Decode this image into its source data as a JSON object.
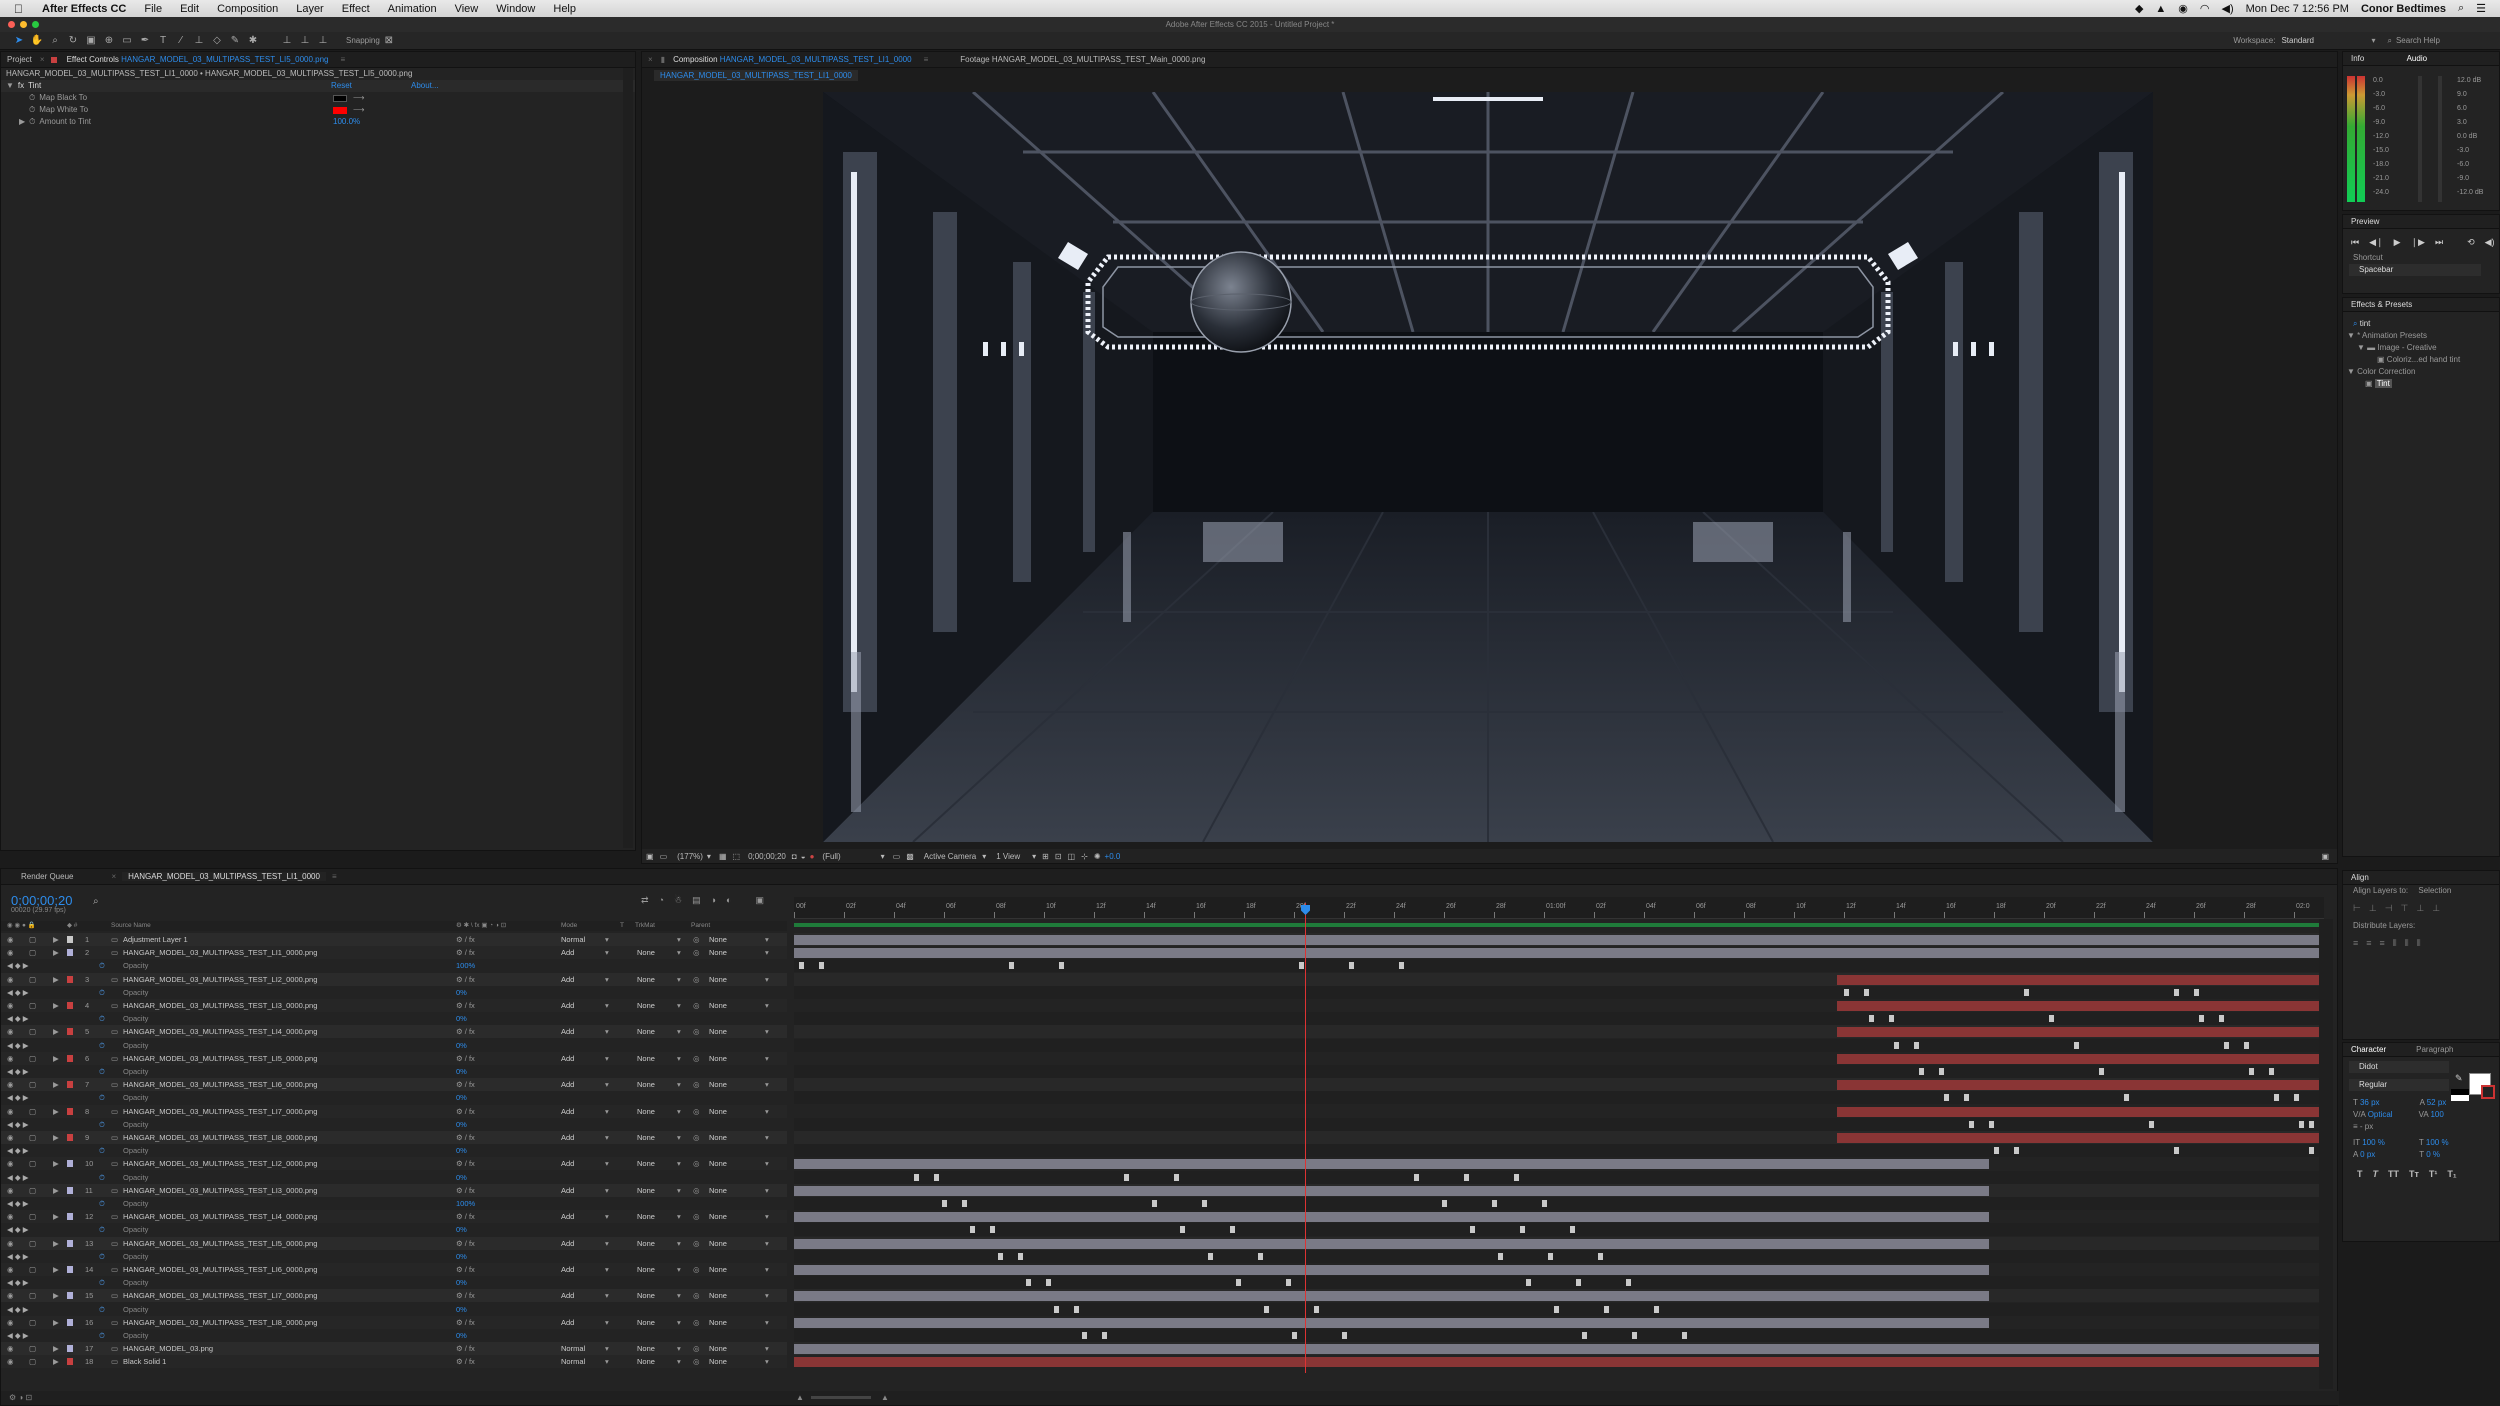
{
  "menubar": {
    "app": "After Effects CC",
    "items": [
      "File",
      "Edit",
      "Composition",
      "Layer",
      "Effect",
      "Animation",
      "View",
      "Window",
      "Help"
    ],
    "clock": "Mon Dec 7  12:56 PM",
    "user": "Conor Bedtimes"
  },
  "window_title": "Adobe After Effects CC 2015 - Untitled Project *",
  "toolbar": {
    "snapping": "Snapping",
    "workspace_label": "Workspace:",
    "workspace_value": "Standard",
    "search_help": "Search Help"
  },
  "left_panel": {
    "tab_project": "Project",
    "tab_effect_controls_prefix": "Effect Controls",
    "tab_effect_controls_name": "HANGAR_MODEL_03_MULTIPASS_TEST_LI5_0000.png",
    "breadcrumb": "HANGAR_MODEL_03_MULTIPASS_TEST_LI1_0000 • HANGAR_MODEL_03_MULTIPASS_TEST_LI5_0000.png",
    "effect_name": "Tint",
    "reset": "Reset",
    "about": "About...",
    "map_black": "Map Black To",
    "map_white": "Map White To",
    "amount_label": "Amount to Tint",
    "amount_value": "100.0%",
    "colors": {
      "black": "#000000",
      "white": "#ff0000"
    }
  },
  "viewer": {
    "tab_comp_prefix": "Composition",
    "tab_comp_name": "HANGAR_MODEL_03_MULTIPASS_TEST_LI1_0000",
    "tab_footage": "Footage HANGAR_MODEL_03_MULTIPASS_TEST_Main_0000.png",
    "sub_tab": "HANGAR_MODEL_03_MULTIPASS_TEST_LI1_0000",
    "zoom": "(177%)",
    "timecode": "0;00;00;20",
    "resolution": "(Full)",
    "camera": "Active Camera",
    "views": "1 View",
    "exposure": "+0.0"
  },
  "right_panel": {
    "info_tab": "Info",
    "audio_tab": "Audio",
    "audio_left_scale": [
      "0.0",
      "-3.0",
      "-6.0",
      "-9.0",
      "-12.0",
      "-15.0",
      "-18.0",
      "-21.0",
      "-24.0"
    ],
    "audio_right_scale": [
      "12.0 dB",
      "9.0",
      "6.0",
      "3.0",
      "0.0 dB",
      "-3.0",
      "-6.0",
      "-9.0",
      "-12.0 dB"
    ],
    "preview_title": "Preview",
    "shortcut_label": "Shortcut",
    "shortcut_value": "Spacebar",
    "effects_title": "Effects & Presets",
    "effects_search": "tint",
    "tree": [
      "* Animation Presets",
      "Image - Creative",
      "Coloriz...ed hand tint",
      "Color Correction",
      "Tint"
    ],
    "align_title": "Align",
    "align_layers_to": "Align Layers to:",
    "align_selection": "Selection",
    "distribute_layers": "Distribute Layers:",
    "character_tab": "Character",
    "paragraph_tab": "Paragraph",
    "font_family": "Didot",
    "font_style": "Regular",
    "font_size": "36 px",
    "leading": "52 px",
    "kerning": "Optical",
    "tracking": "100",
    "stroke": "- px",
    "vert_scale": "100 %",
    "horiz_scale": "100 %",
    "baseline": "0 px",
    "tsume": "0 %"
  },
  "timeline": {
    "tab_render_queue": "Render Queue",
    "tab_comp": "HANGAR_MODEL_03_MULTIPASS_TEST_LI1_0000",
    "timecode": "0;00;00;20",
    "fps": "00020 (29.97 fps)",
    "headers": {
      "source": "Source Name",
      "mode": "Mode",
      "t": "T",
      "trkmat": "TrkMat",
      "parent": "Parent"
    },
    "ruler": [
      "00f",
      "02f",
      "04f",
      "06f",
      "08f",
      "10f",
      "12f",
      "14f",
      "16f",
      "18f",
      "20f",
      "22f",
      "24f",
      "26f",
      "28f",
      "01:00f",
      "02f",
      "04f",
      "06f",
      "08f",
      "10f",
      "12f",
      "14f",
      "16f",
      "18f",
      "20f",
      "22f",
      "24f",
      "26f",
      "28f",
      "02:0"
    ],
    "layers": [
      {
        "num": "1",
        "name": "Adjustment Layer 1",
        "mode": "Normal",
        "trkmat": "",
        "parent": "None",
        "label": "#c8c8c8",
        "sub": null
      },
      {
        "num": "2",
        "name": "HANGAR_MODEL_03_MULTIPASS_TEST_LI1_0000.png",
        "mode": "Add",
        "trkmat": "None",
        "parent": "None",
        "label": "#b0b0d8",
        "sub": "100%"
      },
      {
        "num": "3",
        "name": "HANGAR_MODEL_03_MULTIPASS_TEST_LI2_0000.png",
        "mode": "Add",
        "trkmat": "None",
        "parent": "None",
        "label": "#c84040",
        "sub": "0%"
      },
      {
        "num": "4",
        "name": "HANGAR_MODEL_03_MULTIPASS_TEST_LI3_0000.png",
        "mode": "Add",
        "trkmat": "None",
        "parent": "None",
        "label": "#c84040",
        "sub": "0%"
      },
      {
        "num": "5",
        "name": "HANGAR_MODEL_03_MULTIPASS_TEST_LI4_0000.png",
        "mode": "Add",
        "trkmat": "None",
        "parent": "None",
        "label": "#c84040",
        "sub": "0%"
      },
      {
        "num": "6",
        "name": "HANGAR_MODEL_03_MULTIPASS_TEST_LI5_0000.png",
        "mode": "Add",
        "trkmat": "None",
        "parent": "None",
        "label": "#c84040",
        "sub": "0%"
      },
      {
        "num": "7",
        "name": "HANGAR_MODEL_03_MULTIPASS_TEST_LI6_0000.png",
        "mode": "Add",
        "trkmat": "None",
        "parent": "None",
        "label": "#c84040",
        "sub": "0%"
      },
      {
        "num": "8",
        "name": "HANGAR_MODEL_03_MULTIPASS_TEST_LI7_0000.png",
        "mode": "Add",
        "trkmat": "None",
        "parent": "None",
        "label": "#c84040",
        "sub": "0%"
      },
      {
        "num": "9",
        "name": "HANGAR_MODEL_03_MULTIPASS_TEST_LI8_0000.png",
        "mode": "Add",
        "trkmat": "None",
        "parent": "None",
        "label": "#c84040",
        "sub": "0%"
      },
      {
        "num": "10",
        "name": "HANGAR_MODEL_03_MULTIPASS_TEST_LI2_0000.png",
        "mode": "Add",
        "trkmat": "None",
        "parent": "None",
        "label": "#b0b0d8",
        "sub": "0%"
      },
      {
        "num": "11",
        "name": "HANGAR_MODEL_03_MULTIPASS_TEST_LI3_0000.png",
        "mode": "Add",
        "trkmat": "None",
        "parent": "None",
        "label": "#b0b0d8",
        "sub": "100%"
      },
      {
        "num": "12",
        "name": "HANGAR_MODEL_03_MULTIPASS_TEST_LI4_0000.png",
        "mode": "Add",
        "trkmat": "None",
        "parent": "None",
        "label": "#b0b0d8",
        "sub": "0%"
      },
      {
        "num": "13",
        "name": "HANGAR_MODEL_03_MULTIPASS_TEST_LI5_0000.png",
        "mode": "Add",
        "trkmat": "None",
        "parent": "None",
        "label": "#b0b0d8",
        "sub": "0%"
      },
      {
        "num": "14",
        "name": "HANGAR_MODEL_03_MULTIPASS_TEST_LI6_0000.png",
        "mode": "Add",
        "trkmat": "None",
        "parent": "None",
        "label": "#b0b0d8",
        "sub": "0%"
      },
      {
        "num": "15",
        "name": "HANGAR_MODEL_03_MULTIPASS_TEST_LI7_0000.png",
        "mode": "Add",
        "trkmat": "None",
        "parent": "None",
        "label": "#b0b0d8",
        "sub": "0%"
      },
      {
        "num": "16",
        "name": "HANGAR_MODEL_03_MULTIPASS_TEST_LI8_0000.png",
        "mode": "Add",
        "trkmat": "None",
        "parent": "None",
        "label": "#b0b0d8",
        "sub": "0%"
      },
      {
        "num": "17",
        "name": "HANGAR_MODEL_03.png",
        "mode": "Normal",
        "trkmat": "None",
        "parent": "None",
        "label": "#b0b0d8",
        "sub": null
      },
      {
        "num": "18",
        "name": "Black Solid 1",
        "mode": "Normal",
        "trkmat": "None",
        "parent": "None",
        "label": "#c84040",
        "sub": null
      }
    ],
    "sub_label": "Opacity",
    "colors": {
      "playhead": "#2d8ceb",
      "red_bar": "#8a3535",
      "grey_bar": "#7a7a86"
    }
  }
}
